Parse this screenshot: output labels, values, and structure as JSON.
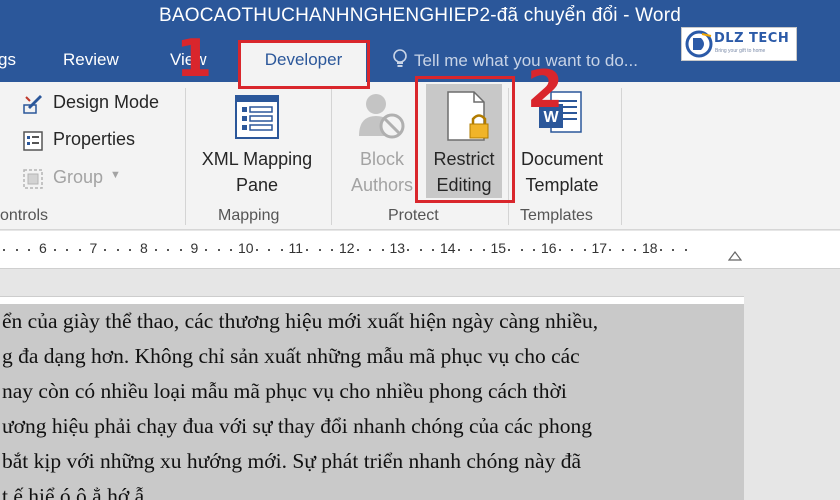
{
  "window": {
    "title": "BAOCAOTHUCHANHNGHENGHIEP2-đã chuyển đổi - Word"
  },
  "tabs": {
    "home_partial": "gs",
    "review": "Review",
    "view_partial": "View",
    "developer": "Developer"
  },
  "tellme": {
    "text": "Tell me what you want to do..."
  },
  "logo": {
    "text": "DLZ TECH",
    "tagline": "Bring your gift to home"
  },
  "ribbon": {
    "controls": {
      "design_mode": "Design Mode",
      "properties": "Properties",
      "group": "Group",
      "label": "ontrols"
    },
    "mapping": {
      "xml_line1": "XML Mapping",
      "xml_line2": "Pane",
      "label": "Mapping"
    },
    "protect": {
      "block_line1": "Block",
      "block_line2": "Authors",
      "restrict_line1": "Restrict",
      "restrict_line2": "Editing",
      "label": "Protect"
    },
    "templates": {
      "doc_line1": "Document",
      "doc_line2": "Template",
      "label": "Templates"
    }
  },
  "annotations": {
    "step1": "1",
    "step2": "2"
  },
  "ruler": {
    "numbers": [
      "6",
      "7",
      "8",
      "9",
      "10",
      "11",
      "12",
      "13",
      "14",
      "15",
      "16",
      "17",
      "18"
    ]
  },
  "document": {
    "lines": [
      "ển của giày thể thao, các thương hiệu mới xuất hiện ngày càng nhiều,",
      "g đa dạng hơn. Không chỉ sản xuất những mẫu mã phục vụ cho các",
      " nay còn có nhiều loại mẫu mã phục vụ cho nhiều phong cách thời",
      "ương hiệu phải chạy đua với sự thay đổi nhanh chóng của các phong",
      "bắt kịp với những xu hướng mới. Sự phát triển  nhanh chóng này đã",
      "t  ế  hiể  ó   ô   ẳ  hớ  ẫ         "
    ]
  },
  "colors": {
    "word_blue": "#2b579a",
    "annotation_red": "#d9262c",
    "selection_gray": "#c9c9c9"
  }
}
